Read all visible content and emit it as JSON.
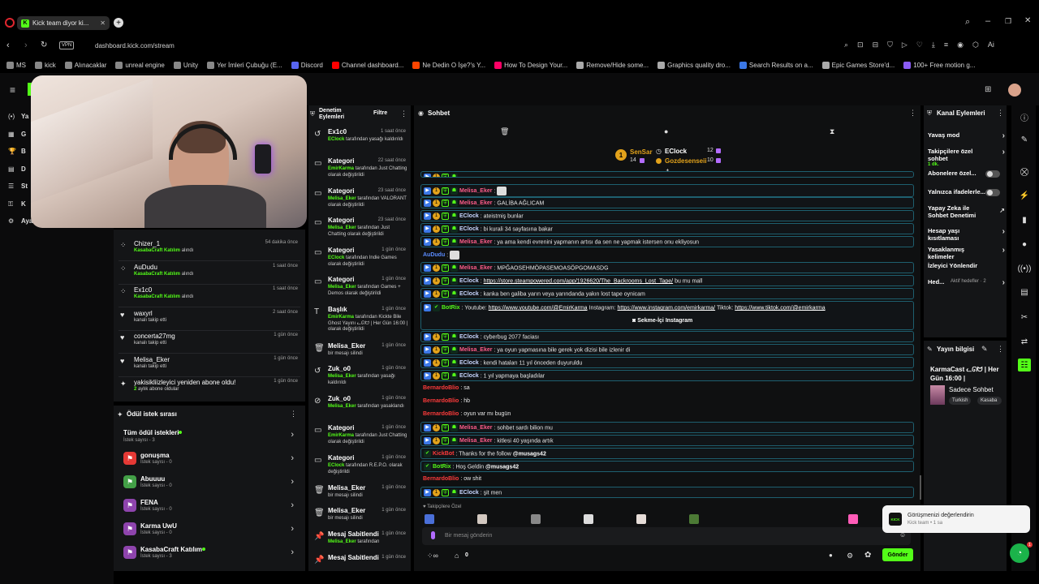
{
  "browser": {
    "tab_title": "Kick team diyor ki...",
    "url": "dashboard.kick.com/stream",
    "vpn": "VPN",
    "bookmarks": [
      "MS",
      "kick",
      "Alınacaklar",
      "unreal engine",
      "Unity",
      "Yer İmleri Çubuğu (E...",
      "Discord",
      "Channel dashboard...",
      "Ne Dedin O İşe?'s Y...",
      "How To Design Your...",
      "Remove/Hide some...",
      "Graphics quality dro...",
      "Search Results on a...",
      "Epic Games Store'd...",
      "100+ Free motion g..."
    ],
    "bookmark_colors": [
      "#888",
      "#888",
      "#888",
      "#888",
      "#888",
      "#888",
      "#5865f2",
      "#ff0000",
      "#ff4500",
      "#ff0066",
      "#aaa",
      "#aaa",
      "#3b78e7",
      "#aaa",
      "#8b5cf6"
    ]
  },
  "left_nav": {
    "items": [
      "Ya",
      "G",
      "B",
      "D",
      "St",
      "K",
      "Aya"
    ]
  },
  "activity": [
    {
      "name": "Chizer_1",
      "sub_green": "KasabaCraft Katılım",
      "sub": "alındı",
      "time": "54 dakika önce",
      "icon": "redeem"
    },
    {
      "name": "AuDudu",
      "sub_green": "KasabaCraft Katılım",
      "sub": "alındı",
      "time": "1 saat önce",
      "icon": "redeem"
    },
    {
      "name": "Ex1c0",
      "sub_green": "KasabaCraft Katılım",
      "sub": "alındı",
      "time": "1 saat önce",
      "icon": "redeem"
    },
    {
      "name": "waxyrl",
      "sub_green": "",
      "sub": "kanalı takip etti",
      "time": "2 saat önce",
      "icon": "heart"
    },
    {
      "name": "concerta27mg",
      "sub_green": "",
      "sub": "kanalı takip etti",
      "time": "1 gün önce",
      "icon": "heart"
    },
    {
      "name": "Melisa_Eker",
      "sub_green": "",
      "sub": "kanalı takip etti",
      "time": "1 gün önce",
      "icon": "heart"
    },
    {
      "name": "yakisikliizleyici yeniden abone oldu!",
      "sub_green": "2",
      "sub": "aylık abone oldular",
      "time": "1 gün önce",
      "icon": "star"
    }
  ],
  "rewards": {
    "title": "Ödül istek sırası",
    "all_label": "Tüm ödül istekleri",
    "all_sub": "İstek sayısı - 3",
    "items": [
      {
        "name": "gonuşma",
        "sub": "İstek sayısı - 0",
        "color": "#e53935"
      },
      {
        "name": "Abuuuu",
        "sub": "İstek sayısı - 0",
        "color": "#43a047"
      },
      {
        "name": "FENA",
        "sub": "İstek sayısı - 0",
        "color": "#8e44ad"
      },
      {
        "name": "Karma UwU",
        "sub": "İstek sayısı - 0",
        "color": "#8e44ad"
      },
      {
        "name": "KasabaCraft Katılım",
        "sub": "İstek sayısı - 3",
        "color": "#8e44ad"
      }
    ]
  },
  "moderation": {
    "title": "Denetim Eylemleri",
    "filter": "Filtre",
    "items": [
      {
        "title": "Ex1c0",
        "time": "1 saat önce",
        "icon": "undo",
        "who": "EClock",
        "desc": "tarafından yasağı kaldırıldı"
      },
      {
        "title": "Kategori",
        "time": "22 saat önce",
        "icon": "category",
        "who": "EmirKarma",
        "desc": "tarafından Just Chatting olarak değiştirildi"
      },
      {
        "title": "Kategori",
        "time": "23 saat önce",
        "icon": "category",
        "who": "Melisa_Eker",
        "desc": "tarafından VALORANT olarak değiştirildi"
      },
      {
        "title": "Kategori",
        "time": "23 saat önce",
        "icon": "category",
        "who": "Melisa_Eker",
        "desc": "tarafından Just Chatting olarak değiştirildi"
      },
      {
        "title": "Kategori",
        "time": "1 gün önce",
        "icon": "category",
        "who": "EClock",
        "desc": "tarafından Indie Games olarak değiştirildi"
      },
      {
        "title": "Kategori",
        "time": "1 gün önce",
        "icon": "category",
        "who": "Melisa_Eker",
        "desc": "tarafından Games + Demos olarak değiştirildi"
      },
      {
        "title": "Başlık",
        "time": "1 gün önce",
        "icon": "title",
        "who": "EmirKarma",
        "desc": "tarafından Kickte Bile Ghost Yayını ᓚᘏᗢ | Her Gün 16:00 | olarak değiştirildi"
      },
      {
        "title": "Melisa_Eker",
        "time": "1 gün önce",
        "icon": "trash",
        "who": "",
        "desc": "bir mesajı silindi"
      },
      {
        "title": "Zuk_o0",
        "time": "1 gün önce",
        "icon": "undo",
        "who": "Melisa_Eker",
        "desc": "tarafından yasağı kaldırıldı"
      },
      {
        "title": "Zuk_o0",
        "time": "1 gün önce",
        "icon": "ban",
        "who": "Melisa_Eker",
        "desc": "tarafından yasaklandı"
      },
      {
        "title": "Kategori",
        "time": "1 gün önce",
        "icon": "category",
        "who": "EmirKarma",
        "desc": "tarafından Just Chatting olarak değiştirildi"
      },
      {
        "title": "Kategori",
        "time": "1 gün önce",
        "icon": "category",
        "who": "EClock",
        "desc": "tarafından R.E.P.O. olarak değiştirildi"
      },
      {
        "title": "Melisa_Eker",
        "time": "1 gün önce",
        "icon": "trash",
        "who": "",
        "desc": "bir mesajı silindi"
      },
      {
        "title": "Melisa_Eker",
        "time": "1 gün önce",
        "icon": "trash",
        "who": "",
        "desc": "bir mesajı silindi"
      },
      {
        "title": "Mesaj Sabitlendi",
        "time": "1 gün önce",
        "icon": "pin",
        "who": "Melisa_Eker",
        "desc": "tarafından"
      },
      {
        "title": "Mesaj Sabitlendi",
        "time": "1 gün önce",
        "icon": "pin",
        "who": "",
        "desc": ""
      }
    ]
  },
  "chat": {
    "title": "Sohbet",
    "leaderboard": [
      {
        "name": "SenSar",
        "count": "14",
        "rank": "1"
      },
      {
        "name": "EClock",
        "count": "12"
      },
      {
        "name": "Gozdesenseii",
        "count": "10"
      }
    ],
    "messages": [
      {
        "user": "",
        "color": "#fff",
        "text": "",
        "box": true,
        "badges": 3
      },
      {
        "user": "Melisa_Eker",
        "color": "#ff5c8a",
        "text": "",
        "box": true,
        "badges": 3,
        "emote": true
      },
      {
        "user": "Melisa_Eker",
        "color": "#ff5c8a",
        "text": "GALİBA AĞLICAM",
        "box": true,
        "badges": 3
      },
      {
        "user": "EClock",
        "color": "#c8d6ff",
        "text": "ateistmiş bunlar",
        "box": true,
        "badges": 3
      },
      {
        "user": "EClock",
        "color": "#c8d6ff",
        "text": "bi kurali 34 sayfasına bakar",
        "box": true,
        "badges": 3
      },
      {
        "user": "Melisa_Eker",
        "color": "#ff5c8a",
        "text": "ya ama kendi evrenini yapmanın artısı da sen ne yapmak istersen onu ekliyosun",
        "box": true,
        "badges": 3
      },
      {
        "user": "AuDudu",
        "color": "#5b8cff",
        "text": "",
        "box": false,
        "badges": 0,
        "emote": true
      },
      {
        "user": "Melisa_Eker",
        "color": "#ff5c8a",
        "text": "MPĞAOSEHMÖPASEMOASÖPGOMASDG",
        "box": true,
        "badges": 3
      },
      {
        "user": "EClock",
        "color": "#c8d6ff",
        "text": "",
        "link": "https://store.steampowered.com/app/1926620/The_Backrooms_Lost_Tape/",
        "after": "bu mu mall",
        "box": true,
        "badges": 3
      },
      {
        "user": "EClock",
        "color": "#c8d6ff",
        "text": "kanka ben galiba yarın veya yarındanda yakın lost tape oynicam",
        "box": true,
        "badges": 3
      }
    ],
    "botrix": {
      "user": "BotRix",
      "text": "Youtube:",
      "yt": "https://www.youtube.com/@EmirKarma",
      "ig_label": "Instagram:",
      "ig": "https://www.instagram.com/emirkarma/",
      "tt_label": "Tiktok:",
      "tt": "https://www.tiktok.com/@emirkarma",
      "button": "Sekme-İçi Instagram"
    },
    "messages2": [
      {
        "user": "EClock",
        "color": "#c8d6ff",
        "text": "cyberbug 2077 faciası",
        "box": true,
        "badges": 3
      },
      {
        "user": "Melisa_Eker",
        "color": "#ff5c8a",
        "text": "ya oyun yapmasına bile gerek yok dizisi bile izlenir di",
        "box": true,
        "badges": 3
      },
      {
        "user": "EClock",
        "color": "#c8d6ff",
        "text": "kendi hataları 11 yıl önceden duyuruldu",
        "box": true,
        "badges": 3
      },
      {
        "user": "EClock",
        "color": "#c8d6ff",
        "text": "1 yıl yapmaya başladılar",
        "box": true,
        "badges": 3
      },
      {
        "user": "BernardoBlio",
        "color": "#ff3b3b",
        "text": "sa",
        "box": false,
        "badges": 0
      },
      {
        "user": "BernardoBlio",
        "color": "#ff3b3b",
        "text": "hb",
        "box": false,
        "badges": 0
      },
      {
        "user": "BernardoBlio",
        "color": "#ff3b3b",
        "text": "oyun var mı bugün",
        "box": false,
        "badges": 0
      },
      {
        "user": "Melisa_Eker",
        "color": "#ff5c8a",
        "text": "sohbet sardı bilion mu",
        "box": true,
        "badges": 3
      },
      {
        "user": "Melisa_Eker",
        "color": "#ff5c8a",
        "text": "kitlesi 40 yaşında artık",
        "box": true,
        "badges": 3
      },
      {
        "user": "KickBot",
        "color": "#ff3b3b",
        "text": "Thanks for the follow",
        "mention": "@musags42",
        "box": true,
        "badges": 1
      },
      {
        "user": "BotRix",
        "color": "#53fc18",
        "text": "Hoş Geldin",
        "mention": "@musags42",
        "box": true,
        "badges": 1
      },
      {
        "user": "BernardoBlio",
        "color": "#ff3b3b",
        "text": "ow shit",
        "box": false,
        "badges": 0
      },
      {
        "user": "EClock",
        "color": "#c8d6ff",
        "text": "şit men",
        "box": true,
        "badges": 3
      }
    ],
    "followers_only": "Takipçilere Özel",
    "input_placeholder": "Bir mesaj gönderin",
    "points": "0",
    "send": "Gönder"
  },
  "channel_actions": {
    "title": "Kanal Eylemleri",
    "items": [
      {
        "label": "Yavaş mod",
        "sub": "",
        "type": "chevron"
      },
      {
        "label": "Takipçilere özel sohbet",
        "sub": "1 dk.",
        "type": "chevron"
      },
      {
        "label": "Abonelere özel...",
        "sub": "",
        "type": "toggle"
      },
      {
        "label": "Yalnızca ifadelerle...",
        "sub": "",
        "type": "toggle"
      },
      {
        "label": "Yapay Zeka ile Sohbet Denetimi",
        "sub": "",
        "type": "external"
      },
      {
        "label": "Hesap yaşı kısıtlaması",
        "sub": "",
        "type": "chevron"
      },
      {
        "label": "Yasaklanmış kelimeler",
        "sub": "",
        "type": "chevron"
      },
      {
        "label": "İzleyici Yönlendir",
        "sub": "",
        "type": "none"
      },
      {
        "label": "Hed...",
        "sub": "Aktif hedefler · 2",
        "type": "chevron"
      }
    ]
  },
  "stream_info": {
    "title": "Yayın bilgisi",
    "stream_title": "KarmaCast ᓚᘏᗢ | Her Gün 16:00 |",
    "category": "Sadece Sohbet",
    "tags": [
      "Turkish",
      "Kasaba"
    ]
  },
  "toast": {
    "title": "Görüşmenizi değerlendirin",
    "sub": "Kick team • 1 sa",
    "logo": "KICK"
  },
  "colors": {
    "accent": "#53fc18",
    "panel": "#141517",
    "bg": "#0b0b0c"
  }
}
